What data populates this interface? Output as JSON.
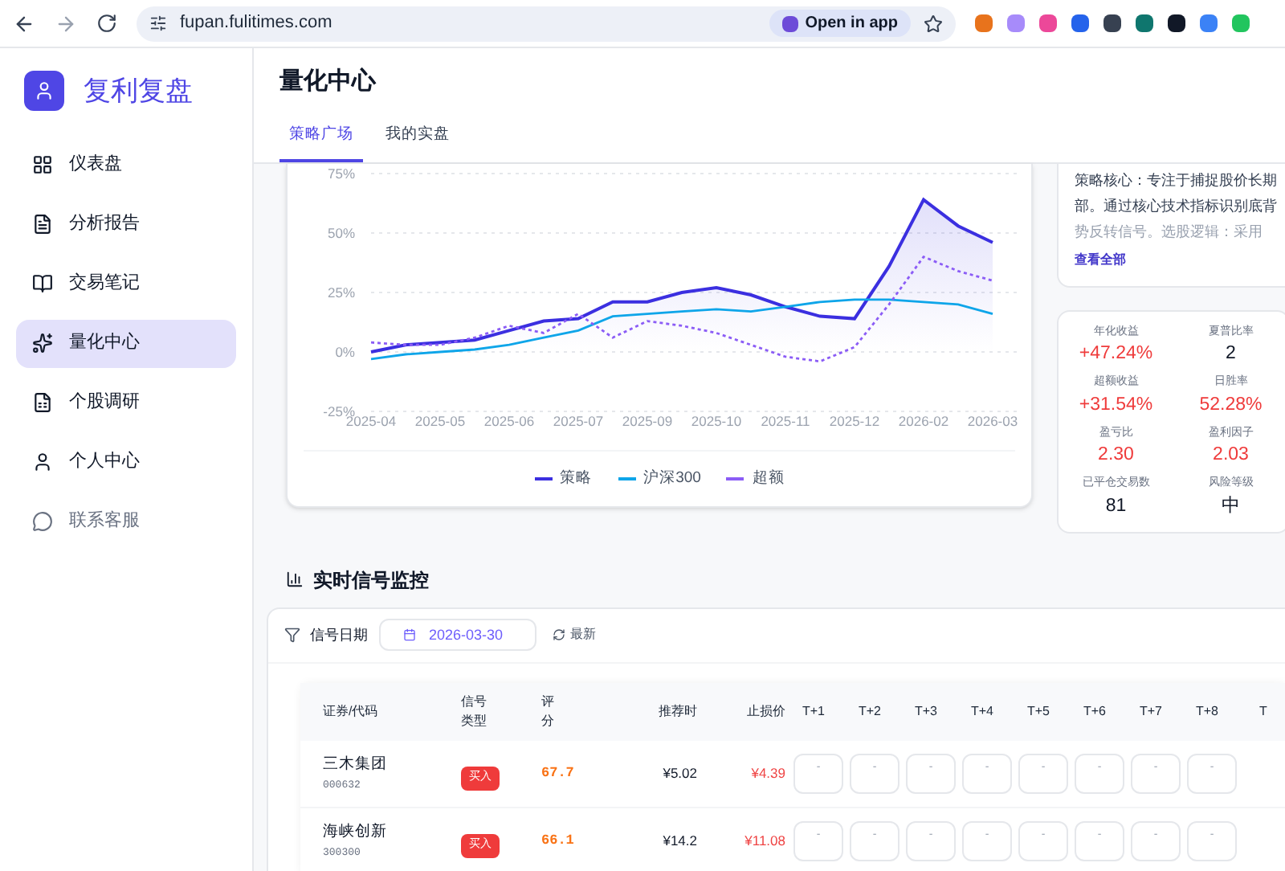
{
  "browser": {
    "url": "fupan.fulitimes.com",
    "open_in_app": "Open in app"
  },
  "sidebar": {
    "brand": "复利复盘",
    "items": [
      {
        "label": "仪表盘",
        "selected": false,
        "disabled": false
      },
      {
        "label": "分析报告",
        "selected": false,
        "disabled": false
      },
      {
        "label": "交易笔记",
        "selected": false,
        "disabled": false
      },
      {
        "label": "量化中心",
        "selected": true,
        "disabled": false
      },
      {
        "label": "个股调研",
        "selected": false,
        "disabled": false
      },
      {
        "label": "个人中心",
        "selected": false,
        "disabled": false
      },
      {
        "label": "联系客服",
        "selected": false,
        "disabled": true
      }
    ]
  },
  "header": {
    "title": "量化中心",
    "tabs": [
      {
        "label": "策略广场",
        "selected": true
      },
      {
        "label": "我的实盘",
        "selected": false
      }
    ]
  },
  "performance_chart": {
    "chart_data": {
      "type": "line",
      "categories": [
        "2025-04",
        null,
        "2025-05",
        null,
        "2025-06",
        null,
        "2025-07",
        null,
        "2025-09",
        null,
        "2025-10",
        null,
        "2025-11",
        null,
        "2025-12",
        null,
        "2026-02",
        null,
        "2026-03"
      ],
      "yticks": [
        {
          "value": -25,
          "label": "-25%"
        },
        {
          "value": 0,
          "label": "0%"
        },
        {
          "value": 25,
          "label": "25%"
        },
        {
          "value": 50,
          "label": "50%"
        },
        {
          "value": 75,
          "label": "75%"
        }
      ],
      "ylim": [
        -25,
        75
      ],
      "grid": true,
      "series": [
        {
          "name": "策略",
          "color": "#3b2fe0",
          "type": "area",
          "line_style": "solid",
          "values": [
            0,
            3,
            4,
            5,
            9,
            13,
            14,
            21,
            21,
            25,
            27,
            24,
            19,
            15,
            14,
            36,
            64,
            53,
            46
          ]
        },
        {
          "name": "沪深300",
          "color": "#0ea5e9",
          "type": "line",
          "line_style": "solid",
          "values": [
            -3,
            -1,
            0,
            1,
            3,
            6,
            9,
            15,
            16,
            17,
            18,
            17,
            19,
            21,
            22,
            22,
            21,
            20,
            16
          ]
        },
        {
          "name": "超额",
          "color": "#8b5cf6",
          "type": "line",
          "line_style": "dashed",
          "values": [
            4,
            3,
            3,
            6,
            11,
            8,
            16,
            6,
            13,
            11,
            8,
            3,
            -2,
            -4,
            2,
            20,
            40,
            34,
            30
          ]
        }
      ]
    }
  },
  "strategy_description": {
    "lines": [
      "策略核心：专注于捕捉股价长期",
      "部。通过核心技术指标识别底背",
      "势反转信号。选股逻辑：采用"
    ],
    "link": "查看全部"
  },
  "stats": [
    {
      "label": "年化收益",
      "value": "+47.24%",
      "color": "#ef3b3b"
    },
    {
      "label": "夏普比率",
      "value": "2",
      "color": "#111827"
    },
    {
      "label": "超额收益",
      "value": "+31.54%",
      "color": "#ef3b3b"
    },
    {
      "label": "日胜率",
      "value": "52.28%",
      "color": "#ef3b3b"
    },
    {
      "label": "盈亏比",
      "value": "2.30",
      "color": "#ef3b3b"
    },
    {
      "label": "盈利因子",
      "value": "2.03",
      "color": "#ef3b3b"
    },
    {
      "label": "已平仓交易数",
      "value": "81",
      "color": "#111827"
    },
    {
      "label": "风险等级",
      "value": "中",
      "color": "#111827"
    }
  ],
  "signal_monitor": {
    "title": "实时信号监控",
    "filter_label": "信号日期",
    "date": "2026-03-30",
    "refresh": "最新",
    "columns": [
      [
        "证券/代码"
      ],
      [
        "信号",
        "类型"
      ],
      [
        "评",
        "分"
      ],
      [
        "推荐时"
      ],
      [
        "止损价"
      ],
      [
        "T+1"
      ],
      [
        "T+2"
      ],
      [
        "T+3"
      ],
      [
        "T+4"
      ],
      [
        "T+5"
      ],
      [
        "T+6"
      ],
      [
        "T+7"
      ],
      [
        "T+8"
      ],
      [
        "T"
      ]
    ],
    "rows": [
      {
        "name": "三木集团",
        "code": "000632",
        "signal": "买入",
        "score": "67.7",
        "recommend_price": "¥5.02",
        "stop_price": "¥4.39",
        "t": [
          "-",
          "-",
          "-",
          "-",
          "-",
          "-",
          "-",
          "-"
        ]
      },
      {
        "name": "海峡创新",
        "code": "300300",
        "signal": "买入",
        "score": "66.1",
        "recommend_price": "¥14.2",
        "stop_price": "¥11.08",
        "t": [
          "-",
          "-",
          "-",
          "-",
          "-",
          "-",
          "-",
          "-"
        ]
      }
    ]
  }
}
